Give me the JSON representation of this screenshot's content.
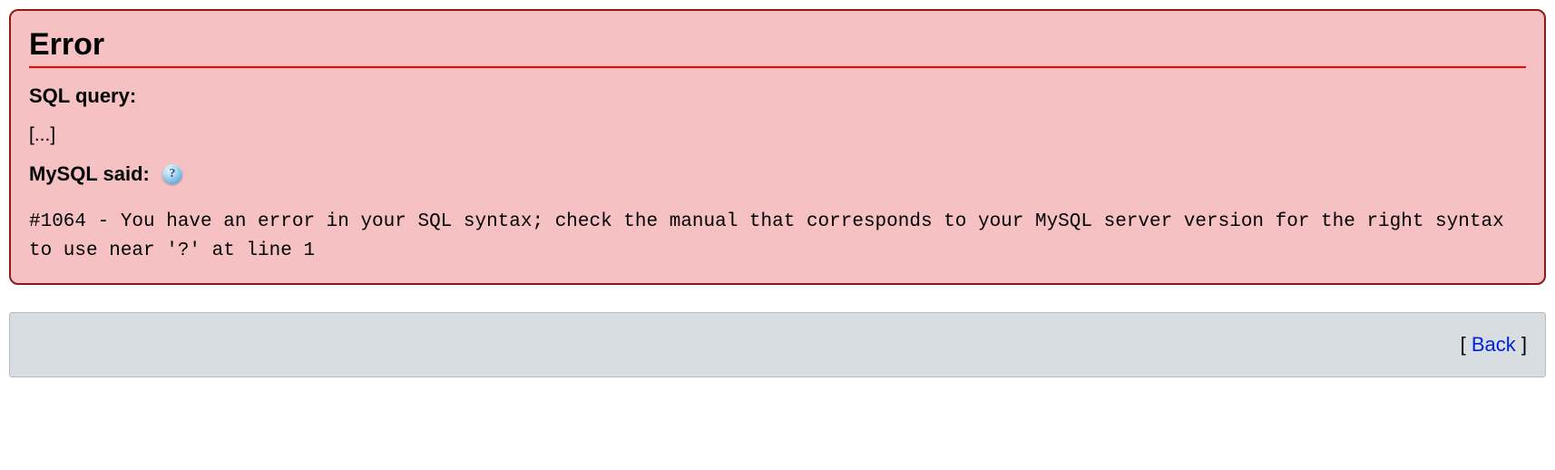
{
  "error": {
    "title": "Error",
    "sql_query_label": "SQL query:",
    "sql_query_text": "[...]",
    "mysql_said_label": "MySQL said:",
    "help_icon_symbol": "?",
    "message": "#1064 - You have an error in your SQL syntax; check the manual that corresponds to your MySQL server version for the right syntax to use near '?' at line 1"
  },
  "footer": {
    "bracket_open": "[ ",
    "back_label": "Back",
    "bracket_close": " ]"
  }
}
